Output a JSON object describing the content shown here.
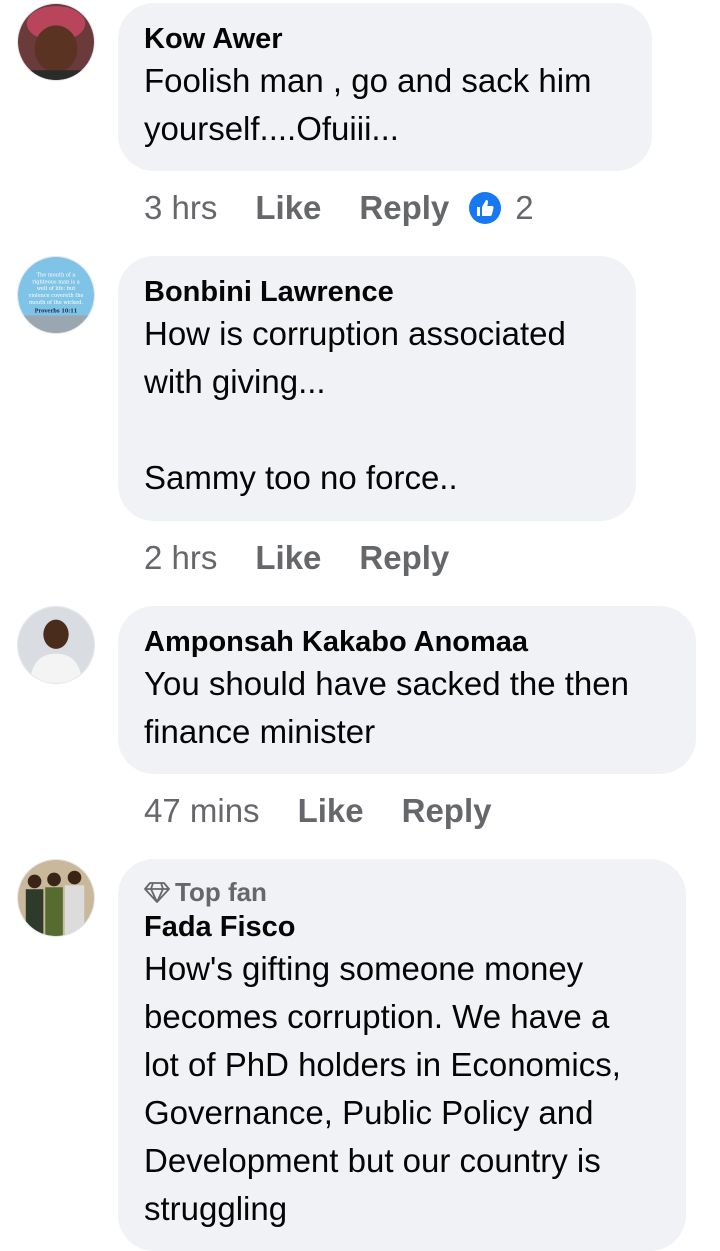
{
  "comments": [
    {
      "author": "Kow Awer",
      "text": "Foolish man , go and sack him\nyourself....Ofuiii...",
      "time": "3 hrs",
      "like_label": "Like",
      "reply_label": "Reply",
      "reaction_count": "2"
    },
    {
      "author": "Bonbini Lawrence",
      "text": "How is corruption associated\nwith giving...\n\nSammy too no force..",
      "time": "2 hrs",
      "like_label": "Like",
      "reply_label": "Reply",
      "avatar_text": [
        "The mouth of a",
        "righteous man is a",
        "well of life: but",
        "violence covereth the",
        "mouth of the wicked.",
        "Proverbs 10:11"
      ]
    },
    {
      "author": "Amponsah Kakabo Anomaa",
      "text": "You should have sacked the then\nfinance minister",
      "time": "47 mins",
      "like_label": "Like",
      "reply_label": "Reply"
    },
    {
      "badge": "Top fan",
      "author": "Fada Fisco",
      "text": "How's gifting someone money\nbecomes corruption. We have a\nlot of PhD holders in Economics,\nGovernance, Public Policy and\nDevelopment but our country is\nstruggling"
    }
  ],
  "icons": {
    "reaction": "thumbs-up-icon",
    "badge": "diamond-icon"
  },
  "colors": {
    "bubble": "#f0f2f5",
    "like_blue": "#1877f2",
    "meta_gray": "#65676b"
  }
}
